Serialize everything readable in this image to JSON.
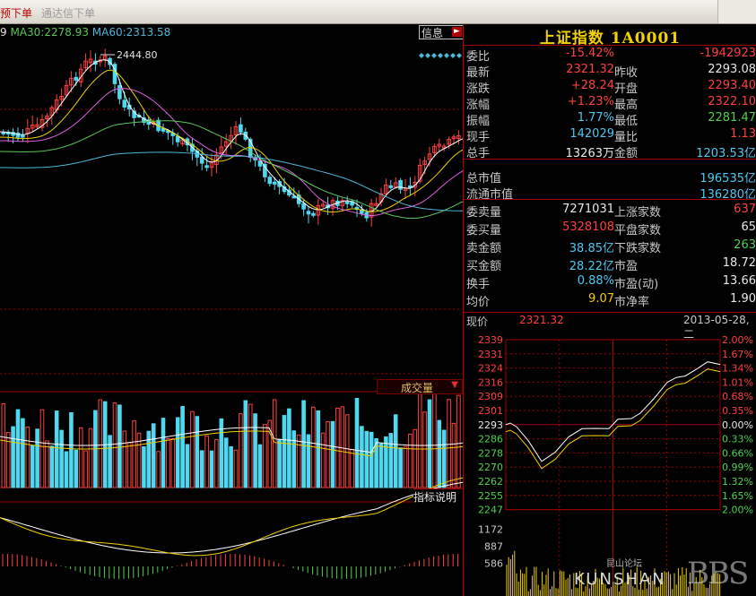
{
  "toolbar": {
    "order_label": "预下单",
    "tdx_order_label": "通达信下单"
  },
  "kline": {
    "ma_legend": {
      "ma_w_value": "9",
      "ma30_label": "MA30:",
      "ma30_value": "2278.93",
      "ma60_label": "MA60:",
      "ma60_value": "2313.58"
    },
    "high_marker": "2444.80",
    "info_button": "信息",
    "volume_button": "成交量",
    "indicator_button": "指标说明"
  },
  "quote": {
    "title": "上证指数 1A0001",
    "rows": [
      {
        "l1": "委比",
        "v1": "-15.42%",
        "c1": "red",
        "l2": "",
        "v2": "-1942923",
        "c2": "red"
      },
      {
        "l1": "最新",
        "v1": "2321.32",
        "c1": "red",
        "l2": "昨收",
        "v2": "2293.08",
        "c2": "wht"
      },
      {
        "l1": "涨跌",
        "v1": "+28.24",
        "c1": "red",
        "l2": "开盘",
        "v2": "2293.40",
        "c2": "red"
      },
      {
        "l1": "涨幅",
        "v1": "+1.23%",
        "c1": "red",
        "l2": "最高",
        "v2": "2322.10",
        "c2": "red"
      },
      {
        "l1": "振幅",
        "v1": "1.77%",
        "c1": "cyan",
        "l2": "最低",
        "v2": "2281.47",
        "c2": "grn"
      },
      {
        "l1": "现手",
        "v1": "142029",
        "c1": "cyan",
        "l2": "量比",
        "v2": "1.13",
        "c2": "red"
      },
      {
        "l1": "总手",
        "v1": "13263万",
        "c1": "wht",
        "l2": "金额",
        "v2": "1203.53亿",
        "c2": "cyan"
      }
    ],
    "mkt": [
      {
        "label": "总市值",
        "value": "196535亿"
      },
      {
        "label": "流通市值",
        "value": "136280亿"
      }
    ],
    "stats": [
      {
        "l1": "委卖量",
        "v1": "7271031",
        "c1": "wht",
        "l2": "上涨家数",
        "v2": "637",
        "c2": "red"
      },
      {
        "l1": "委买量",
        "v1": "5328108",
        "c1": "red",
        "l2": "平盘家数",
        "v2": "65",
        "c2": "wht"
      },
      {
        "l1": "卖金额",
        "v1": "38.85亿",
        "c1": "cyan",
        "l2": "下跌家数",
        "v2": "263",
        "c2": "grn"
      },
      {
        "l1": "买金额",
        "v1": "28.22亿",
        "c1": "cyan",
        "l2": "市盈",
        "v2": "18.72",
        "c2": "wht"
      },
      {
        "l1": "换手",
        "v1": "0.88%",
        "c1": "cyan",
        "l2": "市盈(动)",
        "v2": "13.66",
        "c2": "wht"
      },
      {
        "l1": "均价",
        "v1": "9.07",
        "c1": "yel",
        "l2": "市净率",
        "v2": "1.90",
        "c2": "wht"
      }
    ]
  },
  "intraday": {
    "price_label": "现价",
    "price_value": "2321.32",
    "date": "2013-05-28,二",
    "price_ticks": [
      "2339",
      "2331",
      "2324",
      "2316",
      "2309",
      "2301",
      "2293",
      "2286",
      "2278",
      "2270",
      "2262",
      "2255",
      "2247"
    ],
    "pct_ticks": [
      "2.00%",
      "1.67%",
      "1.34%",
      "1.01%",
      "0.68%",
      "0.35%",
      "0.00%",
      "0.33%",
      "0.66%",
      "0.99%",
      "1.32%",
      "1.65%",
      "2.00%"
    ],
    "vol_ticks": [
      "1172",
      "887",
      "586"
    ]
  },
  "watermark": {
    "cn": "昆山论坛",
    "latin": "KUNSHAN",
    "bbs": "BBS"
  },
  "colors": {
    "up": "#ff4040",
    "down": "#4fd8f0",
    "grid": "#a00000"
  }
}
